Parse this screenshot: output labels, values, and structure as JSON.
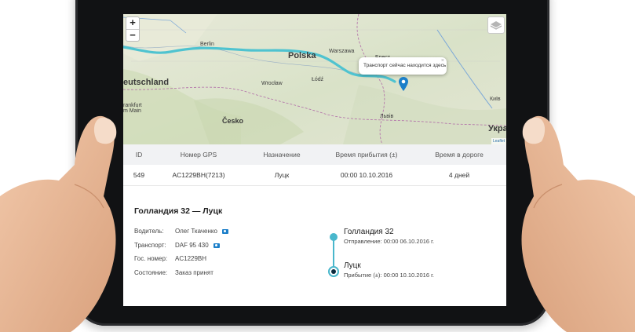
{
  "map": {
    "zoom_in": "+",
    "zoom_out": "−",
    "popup_text": "Транспорт сейчас находится здесь",
    "popup_close": "×",
    "attribution": "Leaflet",
    "labels": {
      "berlin": "Berlin",
      "polska": "Polska",
      "warszawa": "Warszawa",
      "brest": "Брест",
      "deutschland": "eutschland",
      "wroclaw": "Wrocław",
      "lodz": "Łódź",
      "frankfurt": "rankfurt\nm Main",
      "cesko": "Česko",
      "lviv": "Львів",
      "kyiv": "Київ",
      "ukraina": "Укра"
    }
  },
  "table": {
    "headers": [
      "ID",
      "Номер GPS",
      "Назначение",
      "Время прибытия (±)",
      "Время в дороге"
    ],
    "row": [
      "549",
      "AC1229BH(7213)",
      "Луцк",
      "00:00 10.10.2016",
      "4 дней"
    ]
  },
  "details": {
    "title": "Голландия 32 — Луцк",
    "driver_label": "Водитель:",
    "driver_value": "Олег Ткаченко",
    "vehicle_label": "Транспорт:",
    "vehicle_value": "DAF 95 430",
    "plate_label": "Гос. номер:",
    "plate_value": "AC1229BH",
    "status_label": "Состояние:",
    "status_value": "Заказ принят"
  },
  "timeline": {
    "from_name": "Голландия 32",
    "from_sub": "Отправление: 00:00 06.10.2016 г.",
    "to_name": "Луцк",
    "to_sub": "Прибытие (±): 00:00 10.10.2016 г."
  },
  "colors": {
    "route": "#4fc3d0",
    "accent": "#49b7cc",
    "pin": "#1c7fc9"
  }
}
